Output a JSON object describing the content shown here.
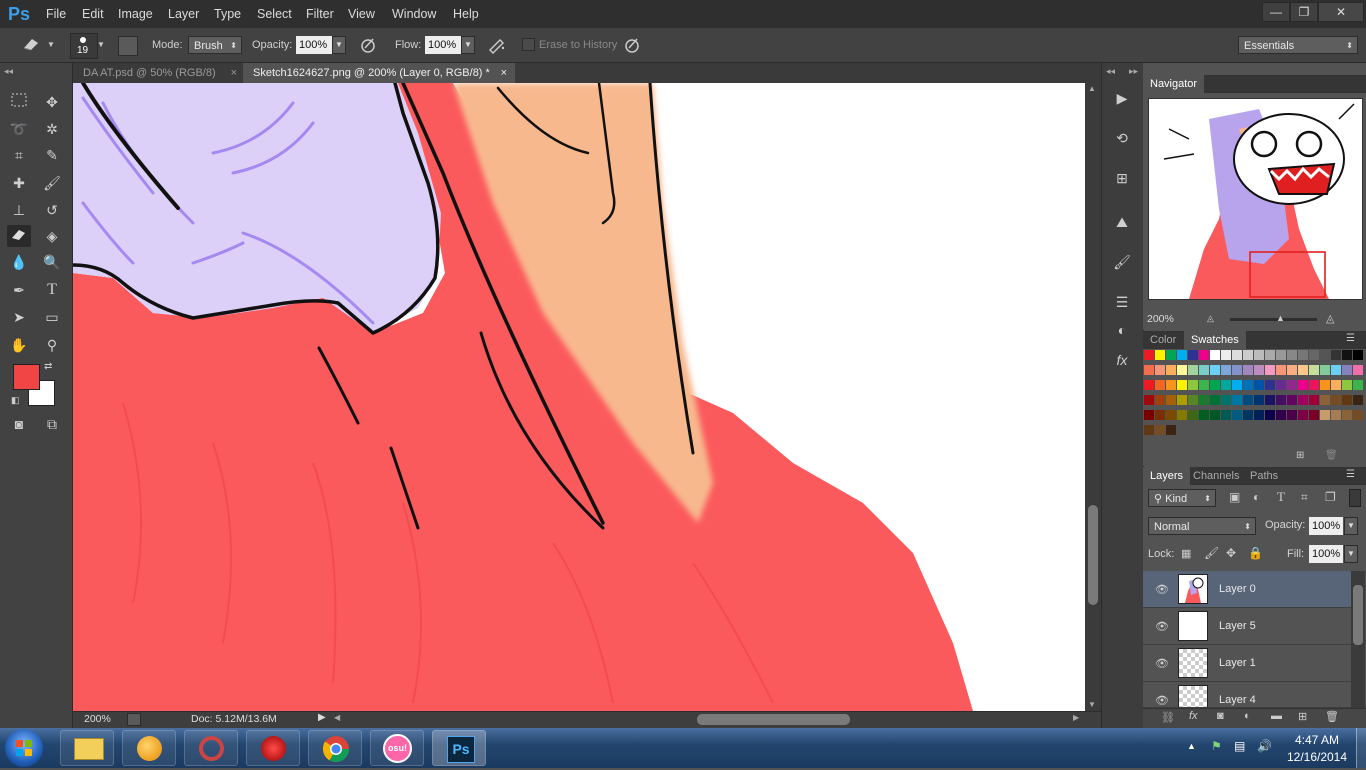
{
  "app": {
    "logo": "Ps"
  },
  "menu": [
    "File",
    "Edit",
    "Image",
    "Layer",
    "Type",
    "Select",
    "Filter",
    "View",
    "Window",
    "Help"
  ],
  "window_controls": {
    "minimize": "—",
    "restore": "❐",
    "close": "✕"
  },
  "options_bar": {
    "brush_size": "19",
    "mode_label": "Mode:",
    "mode_value": "Brush",
    "opacity_label": "Opacity:",
    "opacity_value": "100%",
    "flow_label": "Flow:",
    "flow_value": "100%",
    "erase_history": "Erase to History",
    "workspace": "Essentials"
  },
  "tabs": [
    {
      "label": "DA AT.psd @ 50% (RGB/8)",
      "close": "×"
    },
    {
      "label": "Sketch1624627.png @ 200% (Layer 0, RGB/8) *",
      "close": "×"
    }
  ],
  "status": {
    "zoom": "200%",
    "doc": "Doc: 5.12M/13.6M"
  },
  "colors": {
    "foreground": "#f04545",
    "background": "#ffffff",
    "fill_red": "#fb5a5c",
    "skin": "#f8b88e",
    "hair": "#dccff8"
  },
  "navigator": {
    "title": "Navigator",
    "zoom": "200%"
  },
  "swatches_panel": {
    "tabs": [
      "Color",
      "Swatches"
    ],
    "rows": [
      [
        "#ec1c24",
        "#fff200",
        "#00a651",
        "#00aeef",
        "#2e3192",
        "#ec008c",
        "#ffffff",
        "#eeeeee",
        "#dddddd",
        "#cccccc",
        "#bbbbbb",
        "#aaaaaa",
        "#999999",
        "#888888",
        "#777777",
        "#666666",
        "#555555",
        "#333333",
        "#111111",
        "#000000"
      ],
      [
        "#f26c4f",
        "#f69679",
        "#fbaf5d",
        "#fff799",
        "#a3d39c",
        "#7accc8",
        "#6dcff6",
        "#7da7d9",
        "#8393ca",
        "#a187be",
        "#bd8cbf",
        "#f49ac1",
        "#f7977a",
        "#f9ad81",
        "#fdc68a",
        "#c4df9b",
        "#82ca9c",
        "#6ecff6",
        "#8781bd",
        "#f06eaa"
      ],
      [
        "#ed1c24",
        "#f26522",
        "#f7941d",
        "#fff200",
        "#8dc63f",
        "#39b54a",
        "#00a651",
        "#00a99d",
        "#00aeef",
        "#0072bc",
        "#0054a6",
        "#2e3192",
        "#662d91",
        "#92278f",
        "#ec008c",
        "#ed145b",
        "#f7941d",
        "#fbaf5d",
        "#8dc63f",
        "#39b54a"
      ],
      [
        "#9e0b0f",
        "#a0410d",
        "#a36209",
        "#aba000",
        "#598527",
        "#1a7b30",
        "#007236",
        "#00746b",
        "#0076a3",
        "#004b80",
        "#003471",
        "#1b1464",
        "#440e62",
        "#630460",
        "#9e005d",
        "#9e0039",
        "#8c6239",
        "#754c24",
        "#603913",
        "#3c2415"
      ],
      [
        "#790000",
        "#7b2e00",
        "#7d4900",
        "#827b00",
        "#406618",
        "#005e20",
        "#005826",
        "#005952",
        "#005b7f",
        "#003663",
        "#002157",
        "#0d004c",
        "#32004b",
        "#4b0049",
        "#7b0046",
        "#7a0026",
        "#c69c6d",
        "#a67c52",
        "#8c6239",
        "#754c24"
      ],
      [
        "#603913",
        "#754c24",
        "#3c2415"
      ]
    ]
  },
  "layers_panel": {
    "tabs": [
      "Layers",
      "Channels",
      "Paths"
    ],
    "kind": "Kind",
    "blend": "Normal",
    "opacity_label": "Opacity:",
    "opacity_value": "100%",
    "lock_label": "Lock:",
    "fill_label": "Fill:",
    "fill_value": "100%",
    "layers": [
      {
        "name": "Layer 0",
        "thumb": "sketch",
        "selected": true
      },
      {
        "name": "Layer 5",
        "thumb": "white",
        "selected": false
      },
      {
        "name": "Layer 1",
        "thumb": "transparent",
        "selected": false
      },
      {
        "name": "Layer 4",
        "thumb": "sketch-small",
        "selected": false
      }
    ]
  },
  "taskbar": {
    "time": "4:47 AM",
    "date": "12/16/2014",
    "apps": [
      "windows-explorer",
      "ball-app",
      "media-app",
      "download-app",
      "chrome",
      "osu",
      "photoshop"
    ],
    "osu_label": "osu!",
    "ps_label": "Ps"
  }
}
